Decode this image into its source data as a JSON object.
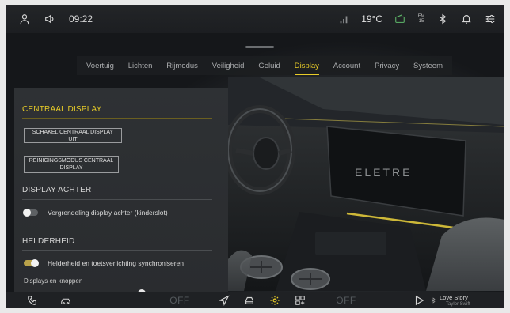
{
  "status_bar": {
    "time": "09:22",
    "temperature": "19°C",
    "fm_badge": "FM 15",
    "icons": [
      "user-icon",
      "volume-icon",
      "signal-icon",
      "radio-icon",
      "bluetooth-icon",
      "bell-icon",
      "settings-sliders-icon"
    ]
  },
  "tabs": [
    {
      "label": "Voertuig",
      "active": false
    },
    {
      "label": "Lichten",
      "active": false
    },
    {
      "label": "Rijmodus",
      "active": false
    },
    {
      "label": "Veiligheid",
      "active": false
    },
    {
      "label": "Geluid",
      "active": false
    },
    {
      "label": "Display",
      "active": true
    },
    {
      "label": "Account",
      "active": false
    },
    {
      "label": "Privacy",
      "active": false
    },
    {
      "label": "Systeem",
      "active": false
    }
  ],
  "panel": {
    "central_display": {
      "title": "CENTRAAL DISPLAY",
      "switch_off_button": "SCHAKEL CENTRAAL DISPLAY UIT",
      "cleaning_mode_button_line1": "REINIGINGSMODUS CENTRAAL",
      "cleaning_mode_button_line2": "DISPLAY"
    },
    "rear_display": {
      "title": "DISPLAY ACHTER",
      "lock_label": "Vergrendeling display achter (kinderslot)",
      "lock_on": false
    },
    "brightness": {
      "title": "HELDERHEID",
      "sync_label": "Helderheid en toetsverlichting synchroniseren",
      "sync_on": true,
      "displays_label": "Displays en knoppen",
      "slider_value": 0.62
    }
  },
  "scene": {
    "dashboard_logo_text": "ELETRE"
  },
  "bottom_bar": {
    "left_off": "OFF",
    "right_off": "OFF",
    "song_title": "Love Story",
    "song_artist": "Taylor Swift",
    "icons": [
      "phone-icon",
      "car-fan-icon",
      "navigation-icon",
      "car-icon",
      "settings-icon",
      "apps-icon",
      "play-icon",
      "bluetooth-icon"
    ]
  },
  "colors": {
    "accent": "#e8cc28",
    "panel_bg": "#2c2f32",
    "bar_bg": "#1f2124"
  }
}
